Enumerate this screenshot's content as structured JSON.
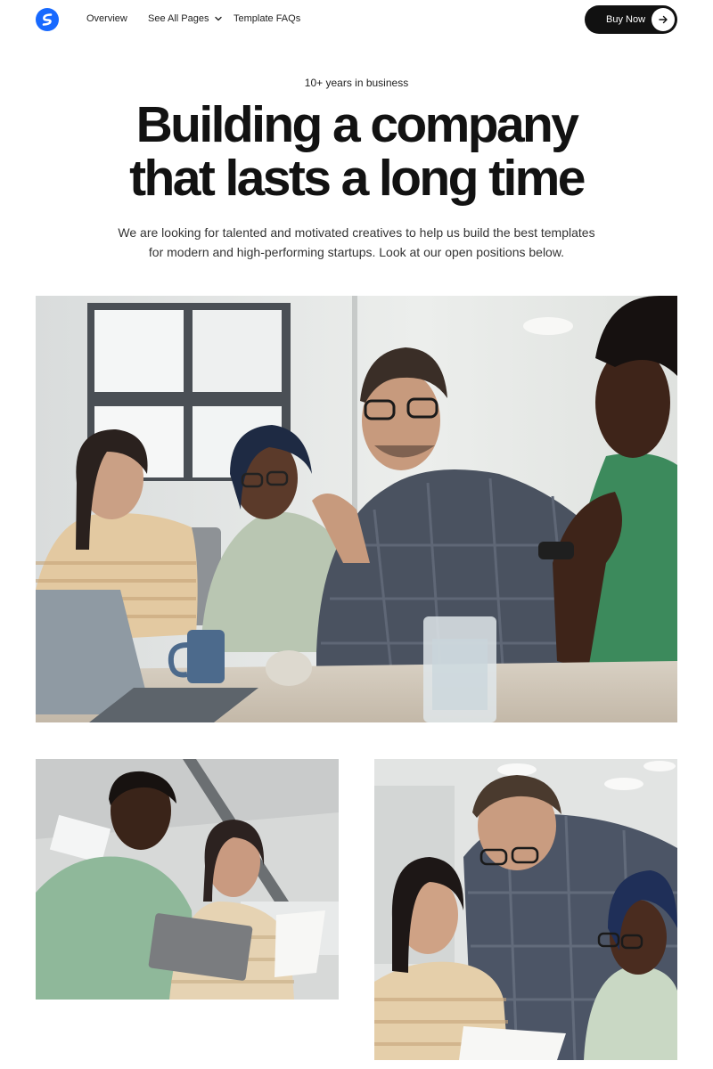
{
  "nav": {
    "logo_icon": "brand-s-logo-icon",
    "links": [
      {
        "label": "Overview"
      },
      {
        "label": "See All Pages",
        "icon": "chevron-down-icon"
      },
      {
        "label": "Template FAQs"
      }
    ],
    "cta": {
      "label": "Buy Now",
      "icon": "arrow-right-icon"
    }
  },
  "hero": {
    "kicker": "10+ years in business",
    "title_line1": "Building a company",
    "title_line2": "that lasts a long time",
    "subtitle_line1": "We are looking for talented and motivated creatives to help us build the best templates",
    "subtitle_line2": "for modern and high-performing startups. Look at our open positions below."
  },
  "colors": {
    "accent": "#1769ff",
    "cta_bg": "#111111",
    "text": "#121212"
  }
}
